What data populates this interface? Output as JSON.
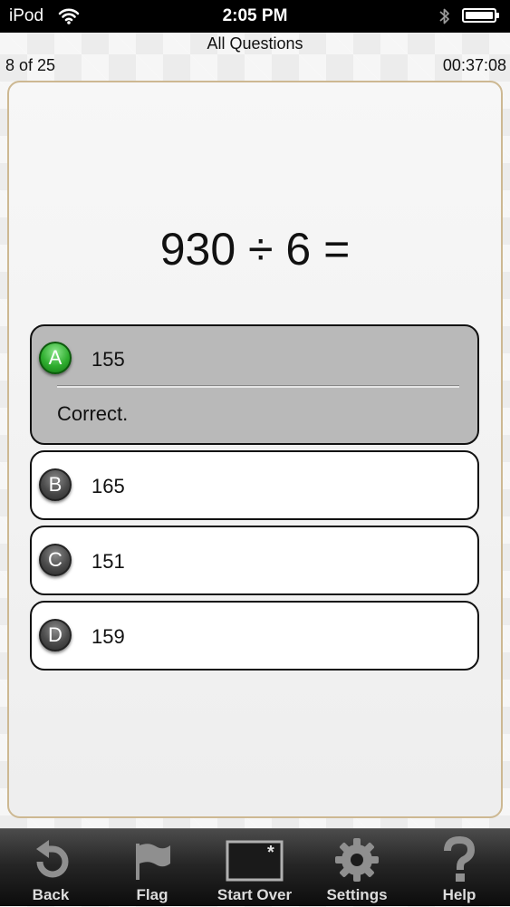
{
  "status_bar": {
    "carrier": "iPod",
    "time": "2:05 PM"
  },
  "header": {
    "title": "All Questions",
    "progress": "8 of 25",
    "timer": "00:37:08"
  },
  "question": {
    "text": "930 ÷ 6 ="
  },
  "answers": [
    {
      "letter": "A",
      "text": "155",
      "state": "correct",
      "feedback": "Correct."
    },
    {
      "letter": "B",
      "text": "165"
    },
    {
      "letter": "C",
      "text": "151"
    },
    {
      "letter": "D",
      "text": "159"
    }
  ],
  "toolbar": {
    "items": [
      {
        "label": "Back",
        "icon": "back-arrow-icon"
      },
      {
        "label": "Flag",
        "icon": "flag-icon"
      },
      {
        "label": "Start Over",
        "icon": "start-over-icon"
      },
      {
        "label": "Settings",
        "icon": "gear-icon"
      },
      {
        "label": "Help",
        "icon": "question-mark-icon"
      }
    ]
  },
  "colors": {
    "correct_badge": "#2fae2f",
    "card_border": "#cdb892",
    "selected_answer_bg": "#b9b9b9"
  }
}
